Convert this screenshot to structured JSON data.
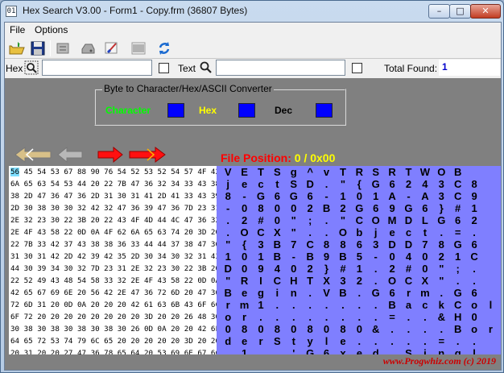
{
  "window": {
    "title": "Hex Search V3.00 - Form1 - Copy.frm (36807 Bytes)",
    "icon": "hex-app-icon"
  },
  "menu": [
    {
      "label": "File"
    },
    {
      "label": "Options"
    }
  ],
  "toolbar": {
    "buttons": [
      {
        "name": "open-file-button",
        "icon": "folder-open-icon"
      },
      {
        "name": "save-button",
        "icon": "floppy-disk-icon"
      },
      {
        "name": "print-preview-button",
        "icon": "print-preview-icon"
      },
      {
        "name": "print-button",
        "icon": "printer-icon"
      },
      {
        "name": "edit-button",
        "icon": "paint-brush-icon"
      },
      {
        "name": "barcode-button",
        "icon": "barcode-icon"
      },
      {
        "name": "refresh-button",
        "icon": "refresh-icon"
      }
    ]
  },
  "search": {
    "hex_label": "Hex",
    "hex_value": "",
    "text_label": "Text",
    "text_value": "",
    "total_label": "Total Found:",
    "total_value": "1"
  },
  "converter": {
    "title": "Byte to Character/Hex/ASCII Converter",
    "character_label": "Character",
    "hex_label": "Hex",
    "dec_label": "Dec",
    "colors": {
      "character": "#00ff00",
      "hex": "#ffff00",
      "dec": "#000000",
      "box": "#0000ff"
    }
  },
  "navigation": [
    {
      "name": "first-arrow",
      "icon": "double-left-arrow-icon"
    },
    {
      "name": "prev-arrow",
      "icon": "left-arrow-icon"
    },
    {
      "name": "next-arrow",
      "icon": "right-arrow-icon"
    },
    {
      "name": "last-arrow",
      "icon": "double-right-arrow-icon"
    }
  ],
  "file_position": {
    "label": "File Position:",
    "value": "0 / 0x00"
  },
  "hex_view": {
    "selected": "56",
    "rows": [
      " 45 54 53 67 88 90 76 54 52 53 52 54 57 4F 42",
      "6A 65 63 54 53 44 20 22 7B 47 36 32 34 33 43 38",
      "38 2D 47 36 47 36 2D 31 30 31 41 2D 41 33 43 39",
      "2D 30 38 30 30 32 42 32 47 36 39 47 36 7D 23 31",
      "2E 32 23 30 22 3B 20 22 43 4F 4D 44 4C 47 36 32",
      "2E 4F 43 58 22 0D 0A 4F 62 6A 65 63 74 20 3D 20",
      "22 7B 33 42 37 43 38 38 36 33 44 44 37 38 47 36",
      "31 30 31 42 2D 42 39 42 35 2D 30 34 30 32 31 43",
      "44 30 39 34 30 32 7D 23 31 2E 32 23 30 22 3B 20",
      "22 52 49 43 48 54 58 33 32 2E 4F 43 58 22 0D 0A",
      "42 65 67 69 6E 20 56 42 2E 47 36 72 6D 20 47 36",
      "72 6D 31 20 0D 0A 20 20 20 42 61 63 6B 43 6F 6C",
      "6F 72 20 20 20 20 20 20 20 20 3D 20 20 26 48 30",
      "30 38 30 38 30 38 30 38 30 26 0D 0A 20 20 42 6F",
      "64 65 72 53 74 79 6C 65 20 20 20 20 20 3D 20 20",
      "20 31 20 20 27 47 36 78 65 64 20 53 69 6E 67 6C"
    ]
  },
  "ascii_view": {
    "rows": [
      "VETSg^vTRSRTWOB",
      "jectSD.\"{G6243C8",
      "8-G6G6-101A-A3C9",
      "-08002B2G69G6}#1",
      ".2#0\";.\"COMDLG62",
      ".OCX\"..Object.=.",
      "\"{3B7C8863DD78G6",
      "101B-B9B5-04021C",
      "D09402}#1.2#0\";.",
      "\"RICHTX32.OCX\"..",
      "Begin.VB.G6rm.G6",
      "rm1.......BackCol",
      "or........=..&H0",
      "080808080&....Bor",
      "derStyle.....=..",
      ".1..'G6xed.Singl"
    ]
  },
  "copyright": "www.Progwhiz.com (c) 2019"
}
